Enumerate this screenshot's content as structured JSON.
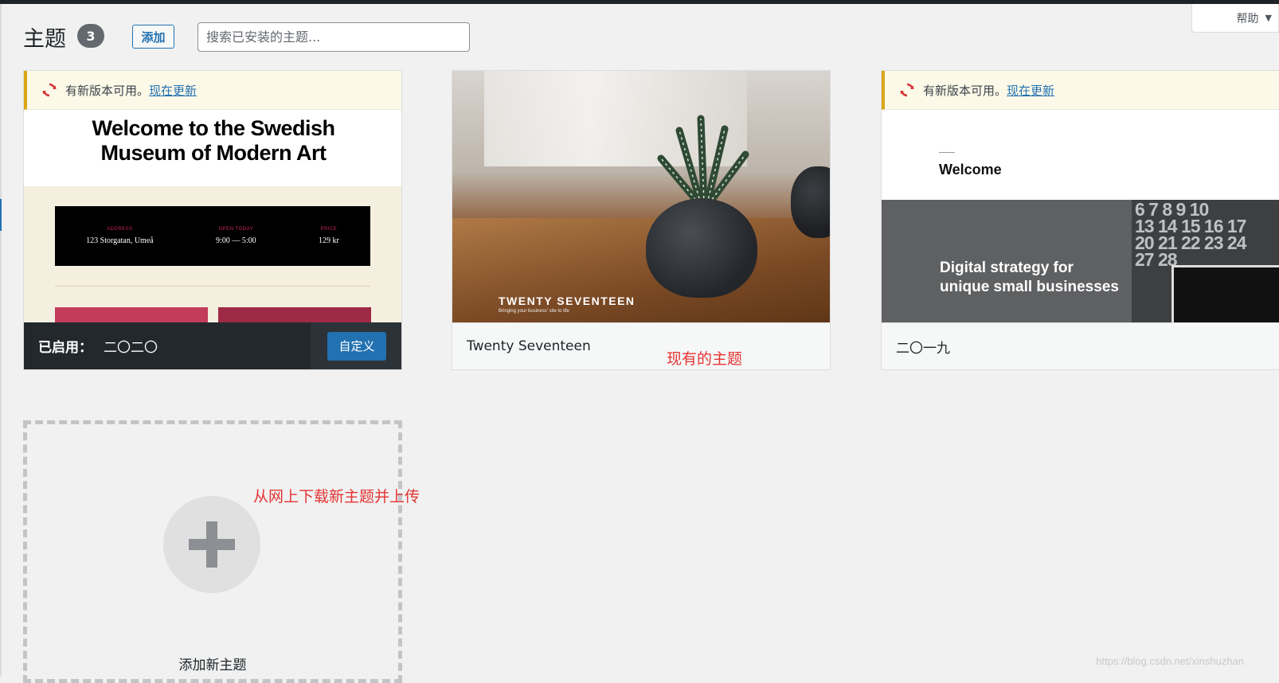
{
  "header": {
    "title": "主题",
    "count": "3",
    "add_label": "添加",
    "search_placeholder": "搜索已安装的主题..."
  },
  "help": {
    "label": "帮助"
  },
  "themes": [
    {
      "name": "二〇二〇",
      "active": true,
      "active_label": "已启用：",
      "customize_label": "自定义",
      "update_notice": {
        "text": "有新版本可用。",
        "link": "现在更新"
      },
      "screenshot": {
        "headline_1": "Welcome to the Swedish",
        "headline_2": "Museum of Modern Art",
        "info": [
          {
            "label": "ADDRESS",
            "value": "123 Storgatan, Umeå"
          },
          {
            "label": "OPEN TODAY",
            "value": "9:00 — 5:00"
          },
          {
            "label": "PRICE",
            "value": "129 kr"
          }
        ]
      }
    },
    {
      "name": "Twenty Seventeen",
      "active": false,
      "screenshot": {
        "brand": "TWENTY SEVENTEEN",
        "tagline": "Bringing your business' site to life"
      }
    },
    {
      "name": "二〇一九",
      "active": false,
      "update_notice": {
        "text": "有新版本可用。",
        "link": "现在更新"
      },
      "screenshot": {
        "welcome": "Welcome",
        "band_line_1": "Digital strategy for",
        "band_line_2": "unique small businesses",
        "calendar": "6 7 8 9 10\n13 14 15 16 17\n20 21 22 23 24\n27 28"
      }
    }
  ],
  "add_new": {
    "label": "添加新主题"
  },
  "annotations": {
    "existing": "现有的主题",
    "upload": "从网上下载新主题并上传"
  },
  "watermark": "https://blog.csdn.net/xinshuzhan",
  "colors": {
    "accent": "#2271b1",
    "badge": "#646970",
    "notice_bg": "#fcf9e8",
    "notice_border": "#dba617",
    "update_icon": "#d63638",
    "annotation": "#e53333",
    "active_bar": "#23282d"
  },
  "icons": {
    "update": "update-arrows-icon",
    "add": "plus-icon",
    "help_arrow": "caret-down-icon"
  }
}
